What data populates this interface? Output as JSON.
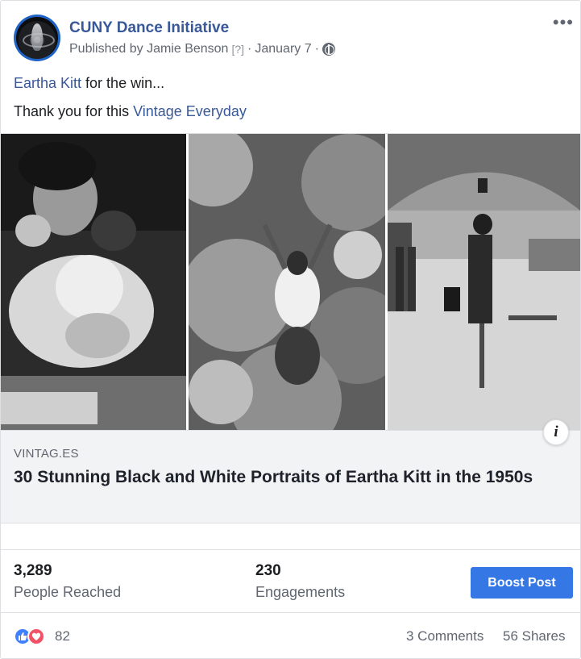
{
  "post": {
    "page_name": "CUNY Dance Initiative",
    "published_by": "Published by Jamie Benson",
    "help_marker": "[?]",
    "date_sep": "·",
    "date": "January 7",
    "privacy_icon": "globe-icon",
    "more_icon": "more-options-icon",
    "more_glyph": "•••",
    "message_line1": {
      "link": "Eartha Kitt",
      "text": " for the win..."
    },
    "message_line2": {
      "text": "Thank you for this ",
      "link": "Vintage Everyday"
    }
  },
  "link_preview": {
    "domain": "VINTAG.ES",
    "title": "30 Stunning Black and White Portraits of Eartha Kitt in the 1950s",
    "info_glyph": "i"
  },
  "insights": {
    "reach_value": "3,289",
    "reach_label": "People Reached",
    "engagement_value": "230",
    "engagement_label": "Engagements",
    "boost_label": "Boost Post"
  },
  "footer": {
    "reactions_count": "82",
    "comments": "3 Comments",
    "shares": "56 Shares"
  },
  "colors": {
    "link_blue": "#385898",
    "button_blue": "#3578e5",
    "like_blue": "#4080ff",
    "love_red": "#f25268",
    "muted_text": "#606770"
  }
}
